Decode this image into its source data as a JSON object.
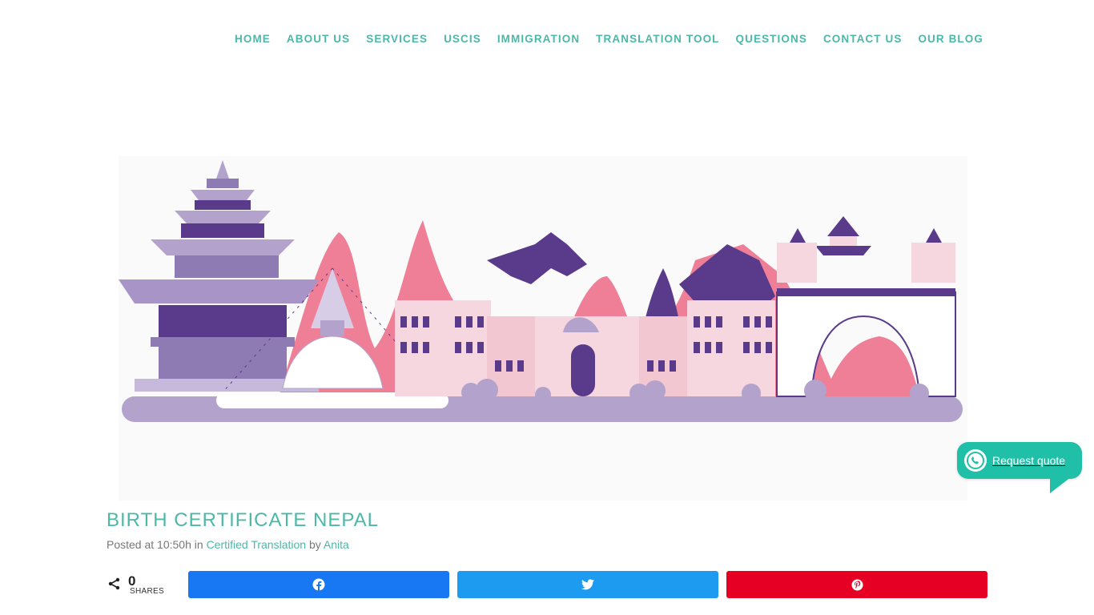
{
  "nav": {
    "items": [
      "HOME",
      "ABOUT US",
      "SERVICES",
      "USCIS",
      "IMMIGRATION",
      "TRANSLATION TOOL",
      "QUESTIONS",
      "CONTACT US",
      "OUR BLOG"
    ]
  },
  "hero": {
    "icon": "nepal-landmarks-illustration"
  },
  "post": {
    "title": "BIRTH CERTIFICATE NEPAL",
    "posted_prefix": "Posted at ",
    "time": "10:50h",
    "in_word": " in ",
    "category": "Certified Translation",
    "by_word": " by ",
    "author": "Anita"
  },
  "share": {
    "count": "0",
    "count_label": "SHARES",
    "buttons": [
      {
        "network": "facebook",
        "icon": "facebook-icon",
        "color": "#1877f2"
      },
      {
        "network": "twitter",
        "icon": "twitter-icon",
        "color": "#1d9bf0"
      },
      {
        "network": "pinterest",
        "icon": "pinterest-icon",
        "color": "#e60023"
      }
    ]
  },
  "whatsapp": {
    "label": "Request quote",
    "icon": "whatsapp-icon",
    "color": "#1fbfa8"
  },
  "colors": {
    "accent": "#4cb8a8",
    "lavender": "#b3a3cc",
    "purple": "#5a3a8a",
    "pink": "#ef7f96"
  }
}
